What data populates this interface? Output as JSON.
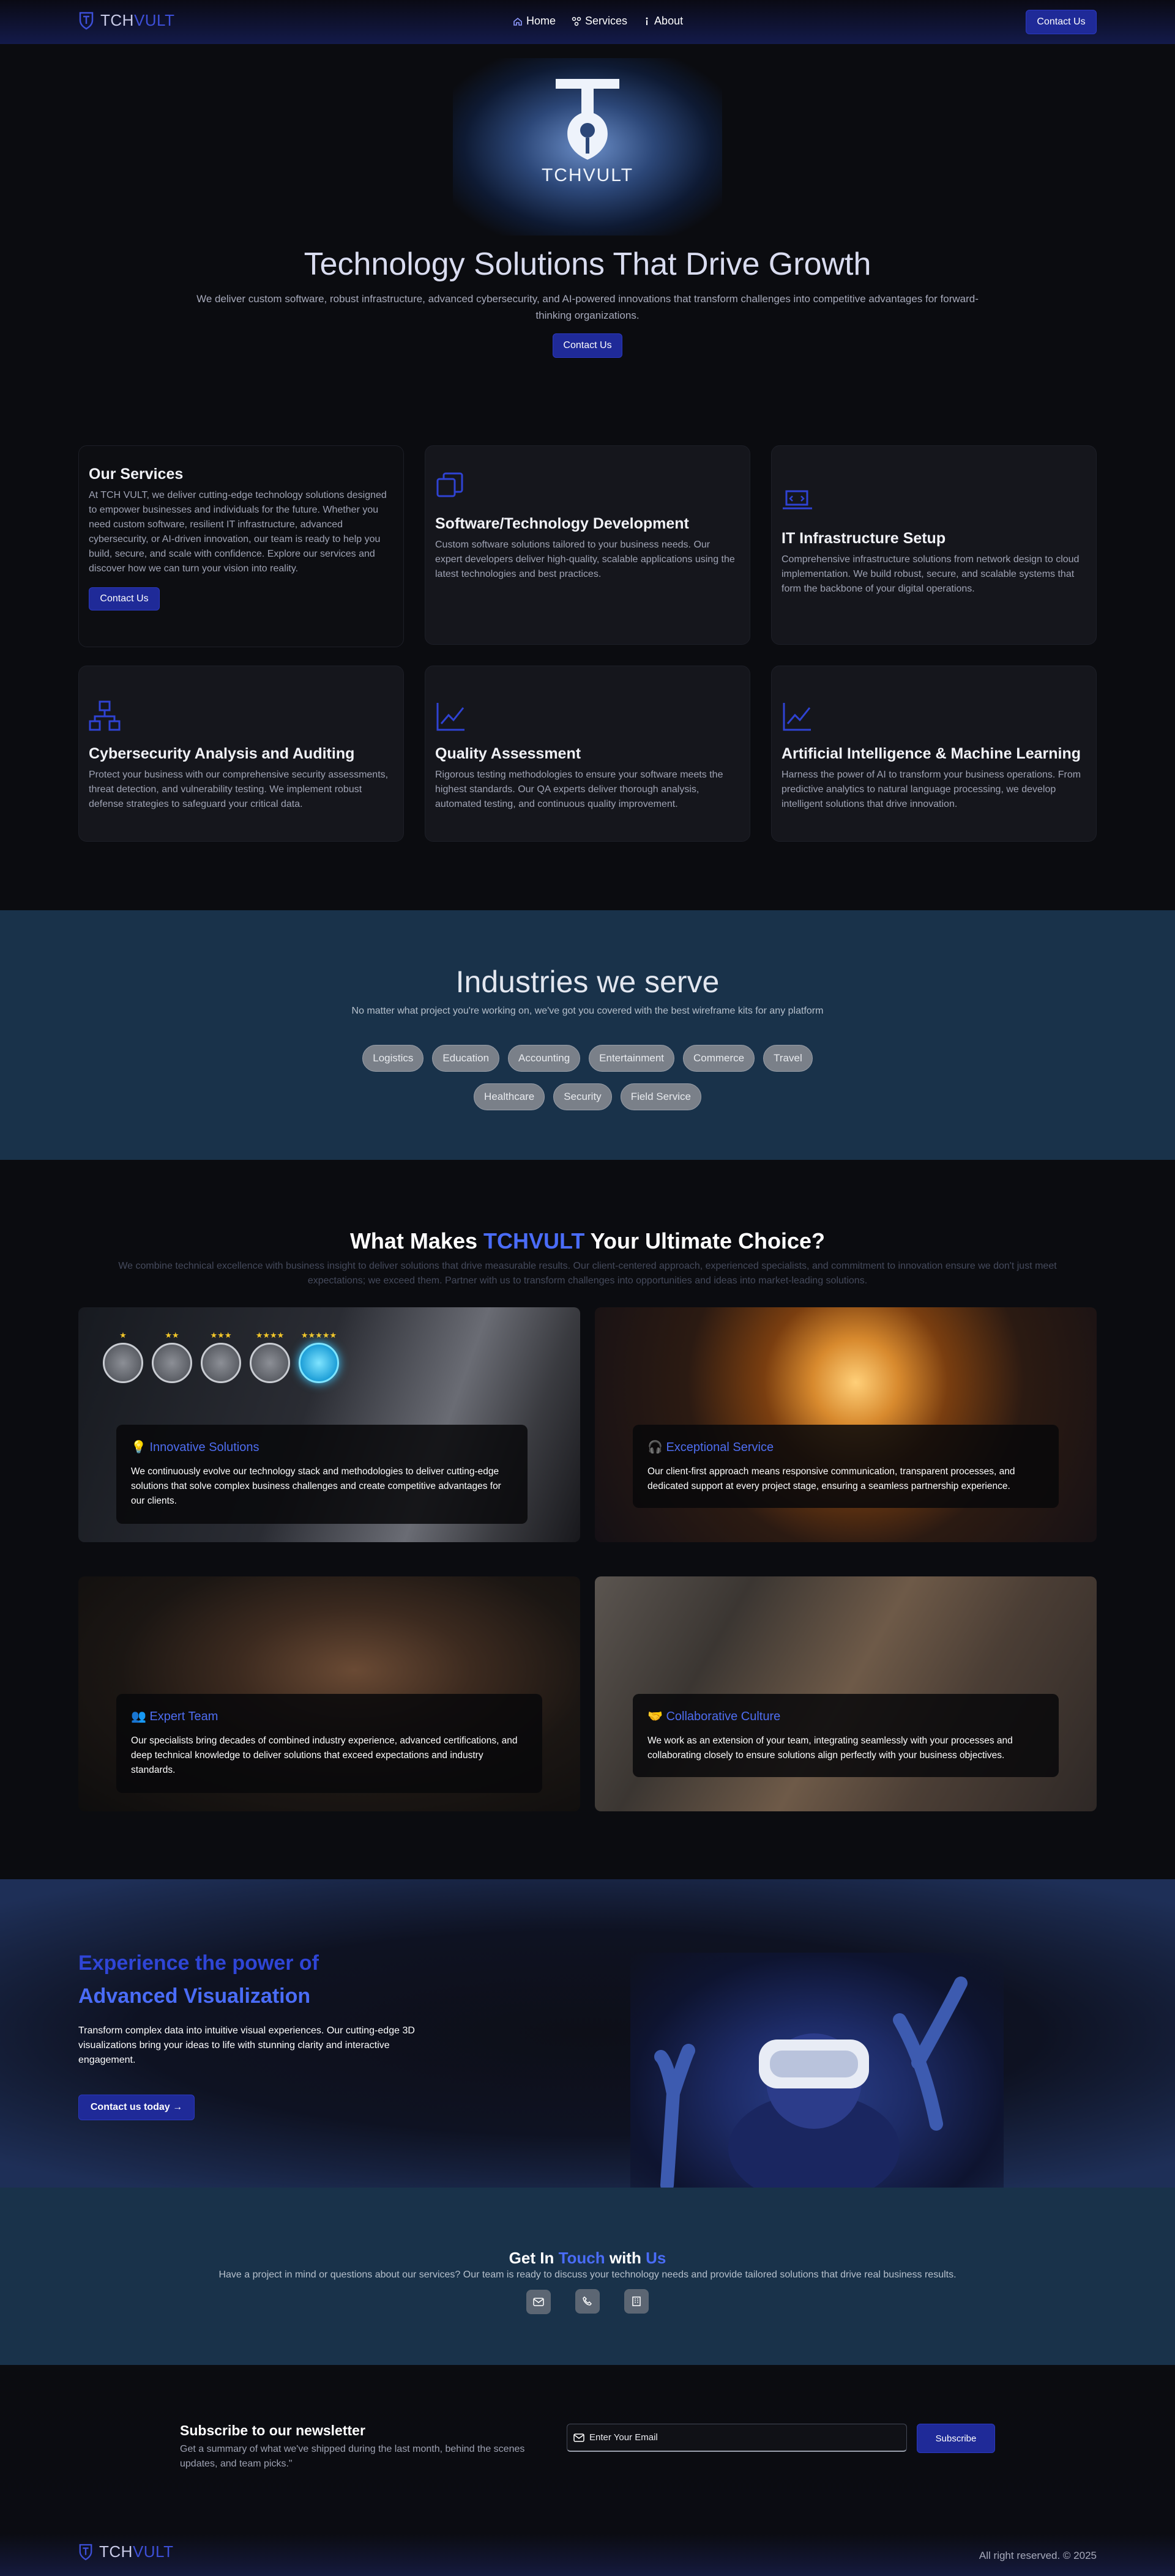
{
  "nav": {
    "logo_a": "TCH",
    "logo_b": "VULT",
    "links": [
      {
        "label": "Home",
        "icon": "home-icon"
      },
      {
        "label": "Services",
        "icon": "services-icon"
      },
      {
        "label": "About",
        "icon": "info-icon"
      }
    ],
    "cta": "Contact Us"
  },
  "hero": {
    "logo_text": "TCHVULT",
    "title": "Technology Solutions That Drive Growth",
    "subtitle": "We deliver custom software, robust infrastructure, advanced cybersecurity, and AI-powered innovations that transform challenges into competitive advantages for forward-thinking organizations.",
    "cta": "Contact Us"
  },
  "services": {
    "intro_title": "Our Services",
    "intro_text": "At TCH VULT, we deliver cutting-edge technology solutions designed to empower businesses and individuals for the future. Whether you need custom software, resilient IT infrastructure, advanced cybersecurity, or AI-driven innovation, our team is ready to help you build, secure, and scale with confidence. Explore our services and discover how we can turn your vision into reality.",
    "intro_cta": "Contact Us",
    "items": [
      {
        "title": "Software/Technology Development",
        "text": "Custom software solutions tailored to your business needs. Our expert developers deliver high-quality, scalable applications using the latest technologies and best practices.",
        "icon": "copy-icon"
      },
      {
        "title": "IT Infrastructure Setup",
        "text": "Comprehensive infrastructure solutions from network design to cloud implementation. We build robust, secure, and scalable systems that form the backbone of your digital operations.",
        "icon": "laptop-code-icon"
      },
      {
        "title": "Cybersecurity Analysis and Auditing",
        "text": "Protect your business with our comprehensive security assessments, threat detection, and vulnerability testing. We implement robust defense strategies to safeguard your critical data.",
        "icon": "network-icon"
      },
      {
        "title": "Quality Assessment",
        "text": "Rigorous testing methodologies to ensure your software meets the highest standards. Our QA experts deliver thorough analysis, automated testing, and continuous quality improvement.",
        "icon": "chart-line-icon"
      },
      {
        "title": "Artificial Intelligence & Machine Learning",
        "text": "Harness the power of AI to transform your business operations. From predictive analytics to natural language processing, we develop intelligent solutions that drive innovation.",
        "icon": "chart-line-icon"
      }
    ]
  },
  "industries": {
    "title": "Industries we serve",
    "subtitle": "No matter what project you're working on, we've got you covered with the best wireframe kits for any platform",
    "row1": [
      "Logistics",
      "Education",
      "Accounting",
      "Entertainment",
      "Commerce",
      "Travel"
    ],
    "row2": [
      "Healthcare",
      "Security",
      "Field Service"
    ]
  },
  "why": {
    "title_a": "What Makes ",
    "title_b": "TCHVULT",
    "title_c": " Your Ultimate Choice?",
    "subtitle": "We combine technical excellence with business insight to deliver solutions that drive measurable results. Our client-centered approach, experienced specialists, and commitment to innovation ensure we don't just meet expectations; we exceed them. Partner with us to transform challenges into opportunities and ideas into market-leading solutions.",
    "ratings": [
      "★",
      "★★",
      "★★★",
      "★★★★",
      "★★★★★"
    ],
    "cards": [
      {
        "emoji": "💡",
        "title": "Innovative Solutions",
        "text": "We continuously evolve our technology stack and methodologies to deliver cutting-edge solutions that solve complex business challenges and create competitive advantages for our clients."
      },
      {
        "emoji": "🎧",
        "title": "Exceptional Service",
        "text": "Our client-first approach means responsive communication, transparent processes, and dedicated support at every project stage, ensuring a seamless partnership experience."
      },
      {
        "emoji": "👥",
        "title": "Expert Team",
        "text": "Our specialists bring decades of combined industry experience, advanced certifications, and deep technical knowledge to deliver solutions that exceed expectations and industry standards."
      },
      {
        "emoji": "🤝",
        "title": "Collaborative Culture",
        "text": "We work as an extension of your team, integrating seamlessly with your processes and collaborating closely to ensure solutions align perfectly with your business objectives."
      }
    ]
  },
  "viz": {
    "title_line1": "Experience the power of",
    "title_line2": "Advanced Visualization",
    "text": "Transform complex data into intuitive visual experiences. Our cutting-edge 3D visualizations bring your ideas to life with stunning clarity and interactive engagement.",
    "cta": "Contact us today →"
  },
  "contact": {
    "title_a": "Get In ",
    "title_b": "Touch",
    "title_c": " with ",
    "title_d": "Us",
    "text": "Have a project in mind or questions about our services? Our team is ready to discuss your technology needs and provide tailored solutions that drive real business results.",
    "icons": [
      "mail-icon",
      "phone-icon",
      "building-icon"
    ]
  },
  "newsletter": {
    "title": "Subscribe to our newsletter",
    "text": "Get a summary of what we've shipped during the last month, behind the scenes updates, and team picks.\"",
    "placeholder": "Enter Your Email",
    "button": "Subscribe"
  },
  "footer": {
    "logo_a": "TCH",
    "logo_b": "VULT",
    "copyright": "All right reserved. © 2025"
  }
}
